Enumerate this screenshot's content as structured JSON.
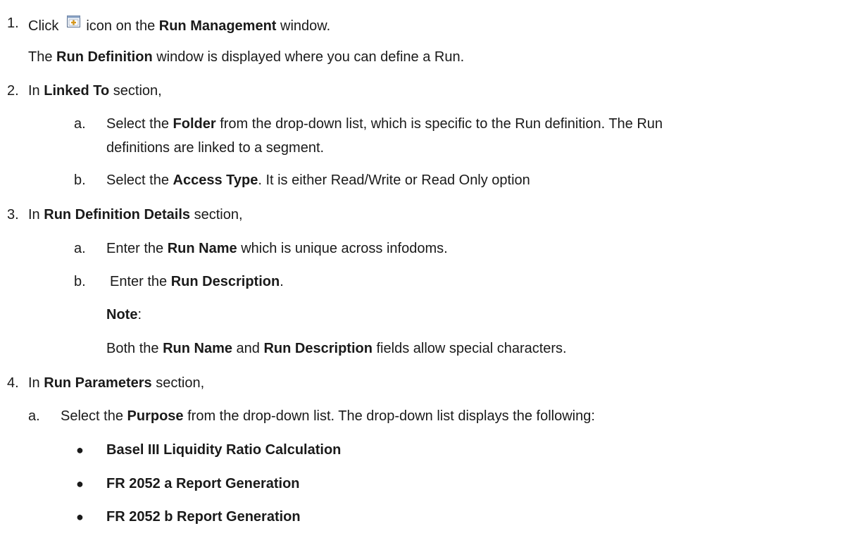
{
  "steps": [
    {
      "num": "1.",
      "pre": "Click",
      "post": "icon on the",
      "bold": "Run Management",
      "tail": "window.",
      "note_pre": "The",
      "note_bold": "Run Definition",
      "note_tail": "window is displayed where you can define a Run."
    },
    {
      "num": "2.",
      "pre": "In",
      "bold": "Linked To",
      "tail": "section,",
      "subs": [
        {
          "letter": "a.",
          "pre": "Select the",
          "bold": "Folder",
          "tail": "from the drop-down list, which is specific to the Run definition. The Run",
          "tail2": "definitions are linked to a segment."
        },
        {
          "letter": "b.",
          "pre": "Select the",
          "bold": "Access Type",
          "tail": ". It is either Read/Write or Read Only option"
        }
      ]
    },
    {
      "num": "3.",
      "pre": "In",
      "bold": "Run Definition Details",
      "tail": "section,",
      "subs": [
        {
          "letter": "a.",
          "pre": "Enter the",
          "bold": "Run Name",
          "tail": "which is unique across infodoms."
        },
        {
          "letter": "b.",
          "pre": "Enter the",
          "bold": "Run Description",
          "tail": "."
        }
      ],
      "note_label": "Note",
      "note_colon": ":",
      "note_pre": "Both the",
      "note_bold1": "Run Name",
      "note_mid": "and",
      "note_bold2": "Run Description",
      "note_tail": "fields allow special characters."
    },
    {
      "num": "4.",
      "pre": "In",
      "bold": "Run Parameters",
      "tail": "section,",
      "subs": [
        {
          "letter": "a.",
          "pre": "Select the",
          "bold": "Purpose",
          "tail": "from the drop-down list. The drop-down list displays the following:"
        }
      ],
      "bullets": [
        "Basel III Liquidity Ratio Calculation",
        "FR 2052 a Report Generation",
        "FR 2052 b Report Generation"
      ]
    }
  ],
  "icons": {
    "add_icon": "add-run-icon"
  },
  "colors": {
    "text": "#1a1a1a",
    "icon_border": "#5a6f8f",
    "icon_plus": "#d4961c"
  }
}
